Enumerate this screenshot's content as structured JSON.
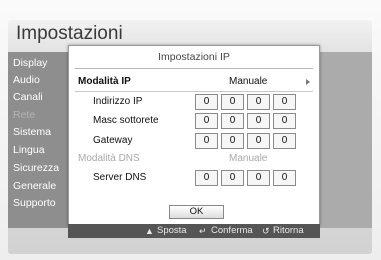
{
  "page": {
    "title": "Impostazioni"
  },
  "sidebar": {
    "items": [
      {
        "label": "Display",
        "active": true
      },
      {
        "label": "Audio",
        "active": true
      },
      {
        "label": "Canali",
        "active": true
      },
      {
        "label": "Rete",
        "active": false
      },
      {
        "label": "Sistema",
        "active": true
      },
      {
        "label": "Lingua",
        "active": true
      },
      {
        "label": "Sicurezza",
        "active": true
      },
      {
        "label": "Generale",
        "active": true
      },
      {
        "label": "Supporto",
        "active": true
      }
    ]
  },
  "dialog": {
    "title": "Impostazioni IP",
    "ip_mode": {
      "label": "Modalità IP",
      "value": "Manuale"
    },
    "ip_address": {
      "label": "Indirizzo IP",
      "octets": [
        "0",
        "0",
        "0",
        "0"
      ]
    },
    "subnet_mask": {
      "label": "Masc sottorete",
      "octets": [
        "0",
        "0",
        "0",
        "0"
      ]
    },
    "gateway": {
      "label": "Gateway",
      "octets": [
        "0",
        "0",
        "0",
        "0"
      ]
    },
    "dns_mode": {
      "label": "Modalità DNS",
      "value": "Manuale",
      "enabled": false
    },
    "dns_server": {
      "label": "Server DNS",
      "octets": [
        "0",
        "0",
        "0",
        "0"
      ]
    },
    "ok_label": "OK"
  },
  "footer": {
    "move_icon": "up-down-arrows-icon",
    "move_label": "Sposta",
    "confirm_icon": "enter-icon",
    "confirm_label": "Conferma",
    "return_icon": "return-icon",
    "return_label": "Ritorna"
  },
  "colors": {
    "sidebar_bg": "#8e8e8e",
    "footer_bg": "#555555",
    "dialog_bg": "#ffffff"
  }
}
